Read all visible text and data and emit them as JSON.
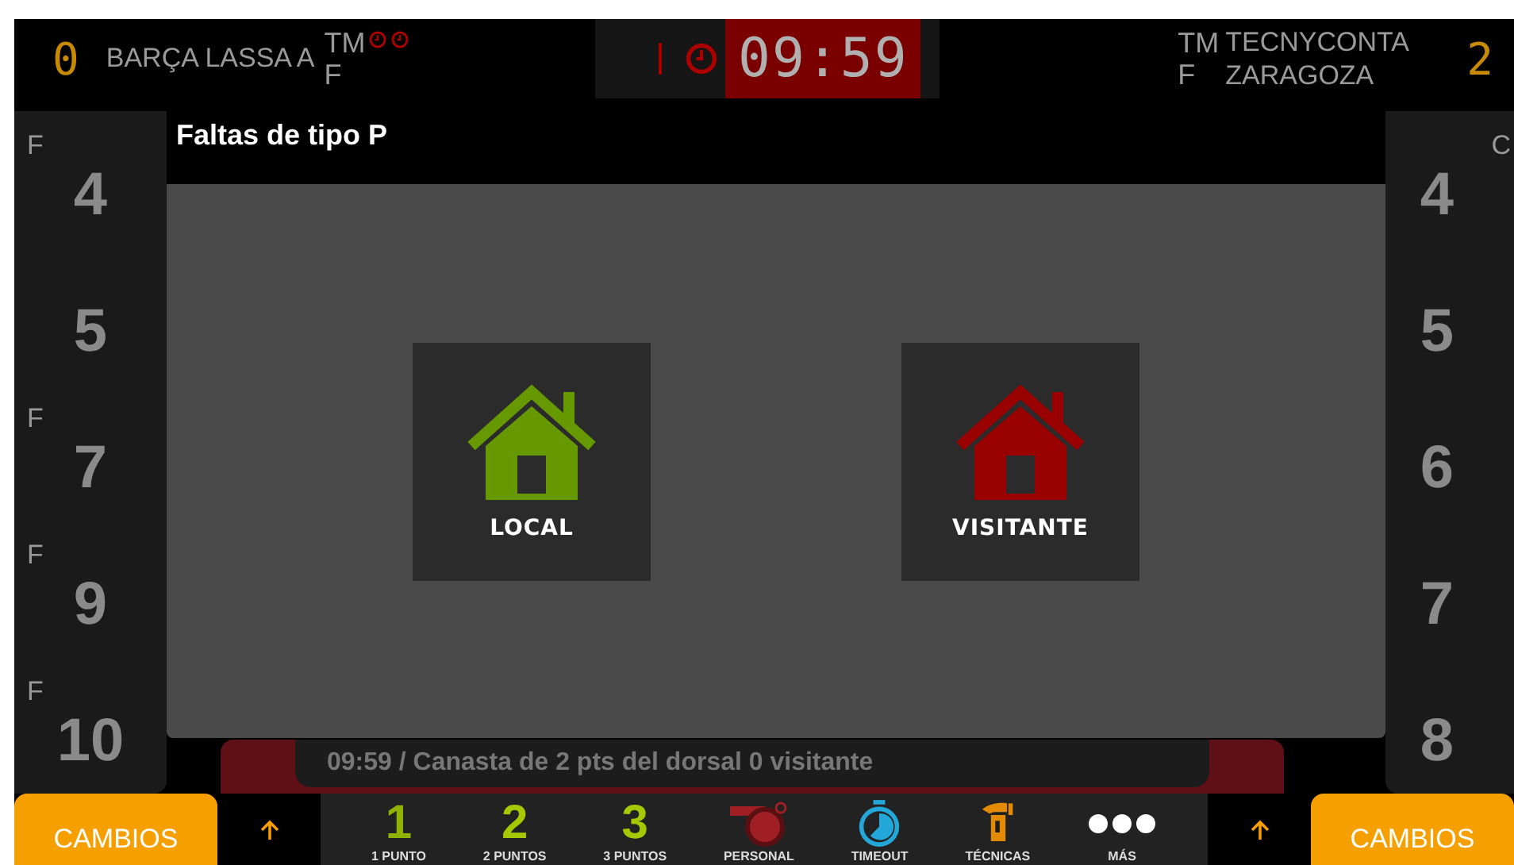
{
  "header": {
    "home": {
      "score": "0",
      "name": "BARÇA LASSA A",
      "tm": "TM",
      "f": "F",
      "timeouts": [
        {
          "used": true
        },
        {
          "used": true
        }
      ]
    },
    "clock": "09:59",
    "away": {
      "score": "2",
      "name": "TECNYCONTA ZARAGOZA",
      "tm": "TM",
      "f": "F"
    }
  },
  "home_players": [
    {
      "number": "4",
      "mark": "F"
    },
    {
      "number": "5"
    },
    {
      "number": "7",
      "mark": "F"
    },
    {
      "number": "9",
      "mark": "F"
    },
    {
      "number": "10",
      "mark": "F"
    }
  ],
  "away_players": [
    {
      "number": "4",
      "mark": "C"
    },
    {
      "number": "5"
    },
    {
      "number": "6"
    },
    {
      "number": "7"
    },
    {
      "number": "8"
    }
  ],
  "log_entry": "09:59 / Canasta de 2 pts del dorsal 0 visitante",
  "actions": [
    {
      "kind": "points",
      "number": "1",
      "label": "1 PUNTO",
      "color": "#8fb300"
    },
    {
      "kind": "points",
      "number": "2",
      "label": "2 PUNTOS",
      "color": "#a6c800"
    },
    {
      "kind": "points",
      "number": "3",
      "label": "3 PUNTOS",
      "color": "#a6c800"
    },
    {
      "kind": "whistle",
      "label": "PERSONAL",
      "color": "#a01f24"
    },
    {
      "kind": "stopwatch",
      "label": "TIMEOUT",
      "color": "#22a7d8"
    },
    {
      "kind": "technical",
      "label": "TÉCNICAS",
      "color": "#e38a00"
    },
    {
      "kind": "more",
      "label": "MÁS",
      "color": "#ffffff"
    }
  ],
  "subs_buttons": [
    "CAMBIOS",
    "CAMBIOS"
  ],
  "dialog": {
    "title": "Faltas de tipo P",
    "options": [
      {
        "label": "LOCAL",
        "color": "#669900"
      },
      {
        "label": "VISITANTE",
        "color": "#990000"
      }
    ]
  }
}
